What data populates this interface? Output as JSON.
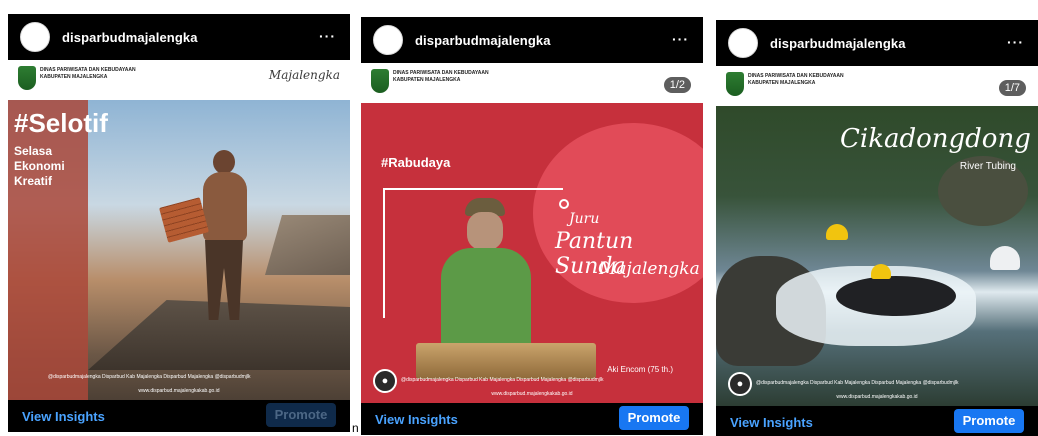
{
  "posts": [
    {
      "username": "disparbudmajalengka",
      "more": "···",
      "brand_text": "DINAS PARIWISATA DAN KEBUDAYAAN KABUPATEN MAJALENGKA",
      "brand_logo": "Majalengka",
      "title": "#Selotif",
      "subtitle": "Selasa Ekonomi Kreatif",
      "footer_line1": "@disparbudmajalengka  Disparbud Kab Majalengka  Disparbud Majalengka  @disparbudmjlk",
      "footer_line2": "www.disparbud.majalengkakab.go.id",
      "view_insights": "View Insights",
      "promote": "Promote"
    },
    {
      "username": "disparbudmajalengka",
      "more": "···",
      "brand_text": "DINAS PARIWISATA DAN KEBUDAYAAN KABUPATEN MAJALENGKA",
      "counter": "1/2",
      "hashtag": "#Rabudaya",
      "script_1": "Juru",
      "script_2": "Pantun Sunda",
      "script_3": "Majalengka",
      "caption": "Aki Encom (75 th.)",
      "footer_line1": "@disparbudmajalengka  Disparbud Kab Majalengka  Disparbud Majalengka  @disparbudmjlk",
      "footer_line2": "www.disparbud.majalengkakab.go.id",
      "view_insights": "View Insights",
      "promote": "Promote"
    },
    {
      "username": "disparbudmajalengka",
      "more": "···",
      "brand_text": "DINAS PARIWISATA DAN KEBUDAYAAN KABUPATEN MAJALENGKA",
      "counter": "1/7",
      "title": "Cikadongdong",
      "subtitle": "River Tubing",
      "footer_line1": "@disparbudmajalengka  Disparbud Kab Majalengka  Disparbud Majalengka  @disparbudmjlk",
      "footer_line2": "www.disparbud.majalengkakab.go.id",
      "view_insights": "View Insights",
      "promote": "Promote"
    }
  ],
  "stray_text": "n",
  "colors": {
    "link_blue": "#4aa3ff",
    "promote_blue": "#1877f2",
    "promote_dim": "#0f2a4a"
  }
}
